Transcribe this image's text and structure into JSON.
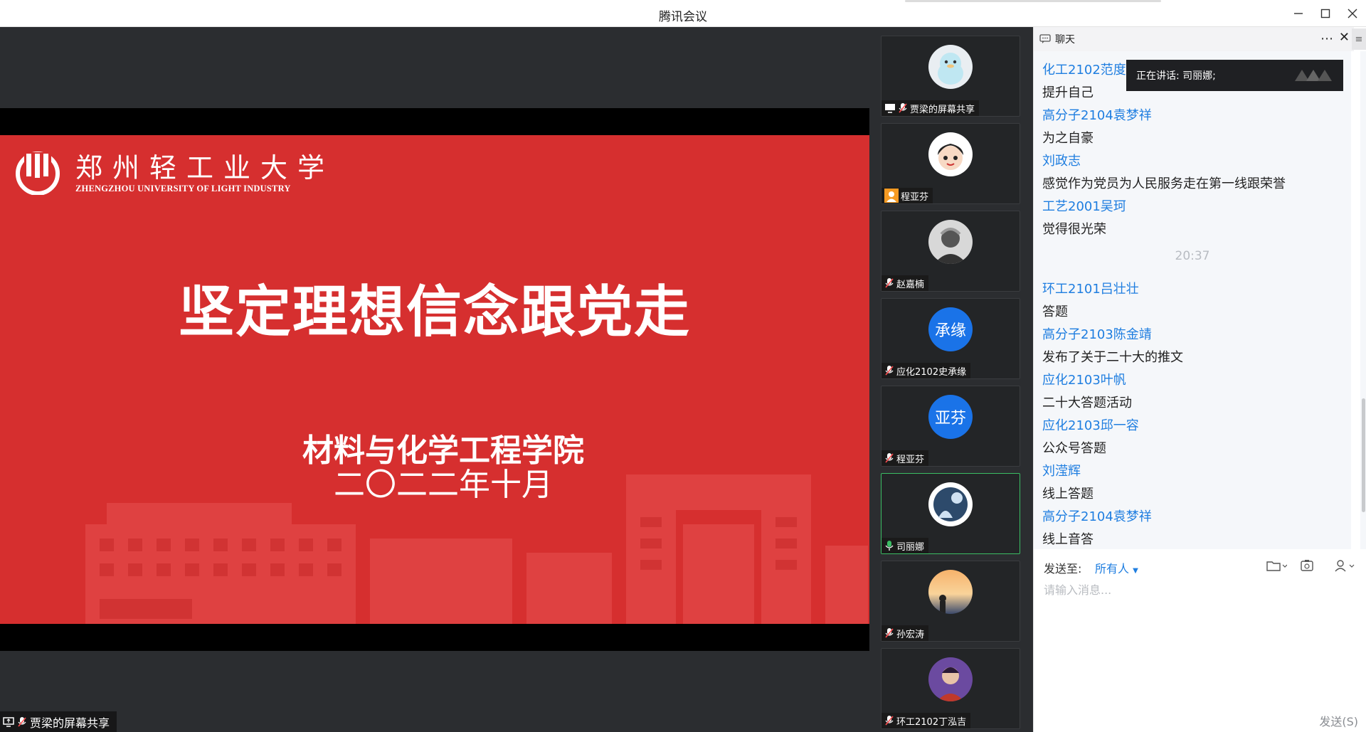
{
  "window": {
    "title": "腾讯会议"
  },
  "slide": {
    "university_cn": "郑州轻工业大学",
    "university_en": "ZHENGZHOU UNIVERSITY OF LIGHT INDUSTRY",
    "title": "坚定理想信念跟党走",
    "subtitle1": "材料与化学工程学院",
    "subtitle2": "二〇二二年十月"
  },
  "share_label": "贾梁的屏幕共享",
  "participants": [
    {
      "name": "贾梁的屏幕共享",
      "avatar": "penguin",
      "icon": "screen-share"
    },
    {
      "name": "程亚芬",
      "avatar": "cartoon",
      "icon": "user"
    },
    {
      "name": "赵嘉楠",
      "avatar": "gray",
      "icon": "mic-muted"
    },
    {
      "name": "应化2102史承缘",
      "avatar_text": "承缘",
      "icon": "mic-muted"
    },
    {
      "name": "程亚芬",
      "avatar_text": "亚芬",
      "icon": "mic-muted"
    },
    {
      "name": "司丽娜",
      "avatar": "circle-art",
      "icon": "mic-on"
    },
    {
      "name": "孙宏涛",
      "avatar": "sunset",
      "icon": "mic-muted"
    },
    {
      "name": "环工2102丁泓吉",
      "avatar": "portrait",
      "icon": "mic-muted"
    }
  ],
  "chat": {
    "header": "聊天",
    "speaking_label": "正在讲话: 司丽娜;",
    "messages": [
      {
        "kind": "name",
        "text": "化工2102范度"
      },
      {
        "kind": "text",
        "text": "提升自己"
      },
      {
        "kind": "name",
        "text": "高分子2104袁梦祥"
      },
      {
        "kind": "text",
        "text": "为之自豪"
      },
      {
        "kind": "name",
        "text": "刘政志"
      },
      {
        "kind": "text",
        "text": "感觉作为党员为人民服务走在第一线跟荣誉"
      },
      {
        "kind": "name",
        "text": "工艺2001吴珂"
      },
      {
        "kind": "text",
        "text": "觉得很光荣"
      },
      {
        "kind": "time",
        "text": "20:37"
      },
      {
        "kind": "name",
        "text": "环工2101吕壮壮"
      },
      {
        "kind": "text",
        "text": "答题"
      },
      {
        "kind": "name",
        "text": "高分子2103陈金靖"
      },
      {
        "kind": "text",
        "text": "发布了关于二十大的推文"
      },
      {
        "kind": "name",
        "text": "应化2103叶帆"
      },
      {
        "kind": "text",
        "text": "二十大答题活动"
      },
      {
        "kind": "name",
        "text": "应化2103邱一容"
      },
      {
        "kind": "text",
        "text": "公众号答题"
      },
      {
        "kind": "name",
        "text": "刘滢辉"
      },
      {
        "kind": "text",
        "text": "线上答题"
      },
      {
        "kind": "name",
        "text": "高分子2104袁梦祥"
      },
      {
        "kind": "text",
        "text": "线上音答"
      }
    ],
    "send_to_label": "发送至:",
    "send_to_value": "所有人",
    "input_placeholder": "请输入消息...",
    "send_button": "发送(S)"
  }
}
